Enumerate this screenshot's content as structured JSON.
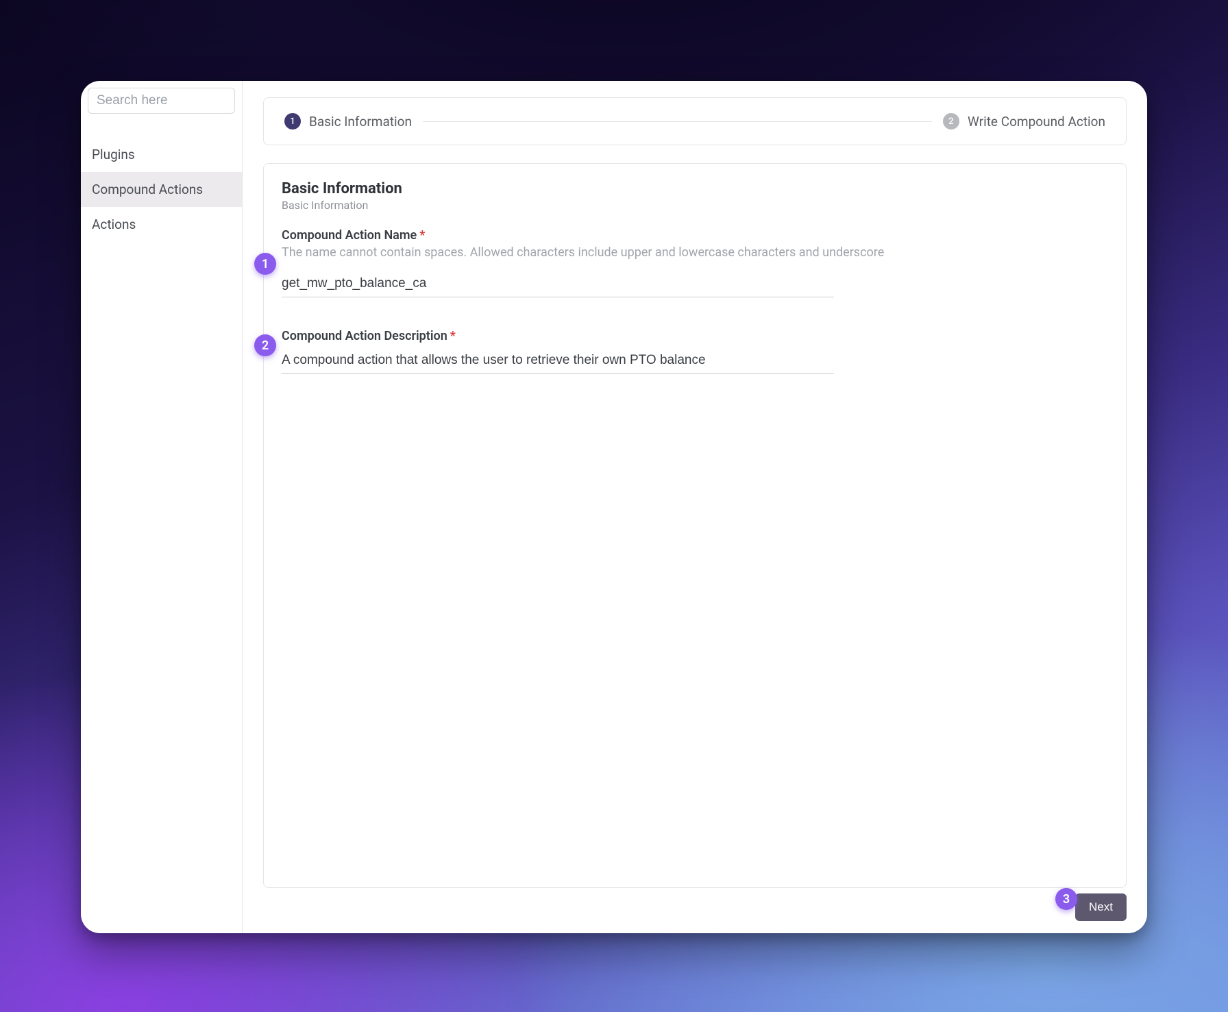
{
  "sidebar": {
    "search_placeholder": "Search here",
    "items": [
      {
        "label": "Plugins"
      },
      {
        "label": "Compound Actions"
      },
      {
        "label": "Actions"
      }
    ],
    "active_index": 1
  },
  "stepper": {
    "steps": [
      {
        "num": "1",
        "label": "Basic Information",
        "active": true
      },
      {
        "num": "2",
        "label": "Write Compound Action",
        "active": false
      }
    ]
  },
  "form": {
    "heading": "Basic Information",
    "subheading": "Basic Information",
    "name_label": "Compound Action Name",
    "name_help": "The name cannot contain spaces. Allowed characters include upper and lowercase characters and underscore",
    "name_value": "get_mw_pto_balance_ca",
    "desc_label": "Compound Action Description",
    "desc_value": "A compound action that allows the user to retrieve their own PTO balance"
  },
  "footer": {
    "next_label": "Next"
  },
  "annotations": {
    "a1": "1",
    "a2": "2",
    "a3": "3"
  }
}
